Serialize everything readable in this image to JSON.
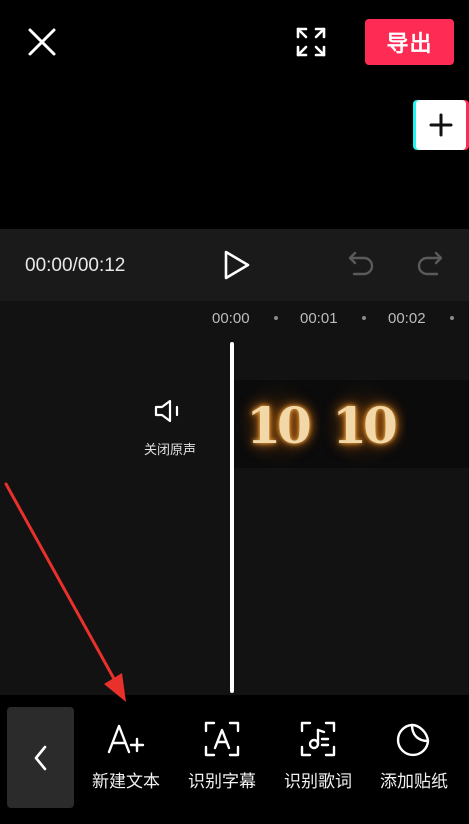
{
  "topbar": {
    "export_label": "导出"
  },
  "player": {
    "time": "00:00/00:12"
  },
  "ruler": {
    "labels": [
      "00:00",
      "00:01",
      "00:02"
    ]
  },
  "audio": {
    "mute_label": "关闭原声"
  },
  "clip": {
    "frames": [
      "10",
      "10"
    ]
  },
  "toolbar": {
    "items": [
      {
        "label": "新建文本",
        "icon": "add-text-icon"
      },
      {
        "label": "识别字幕",
        "icon": "recognize-subtitle-icon"
      },
      {
        "label": "识别歌词",
        "icon": "recognize-lyrics-icon"
      },
      {
        "label": "添加贴纸",
        "icon": "sticker-icon"
      }
    ]
  },
  "colors": {
    "accent": "#fe2c55",
    "cyan": "#25f4ee",
    "annotation": "#e8312a"
  }
}
